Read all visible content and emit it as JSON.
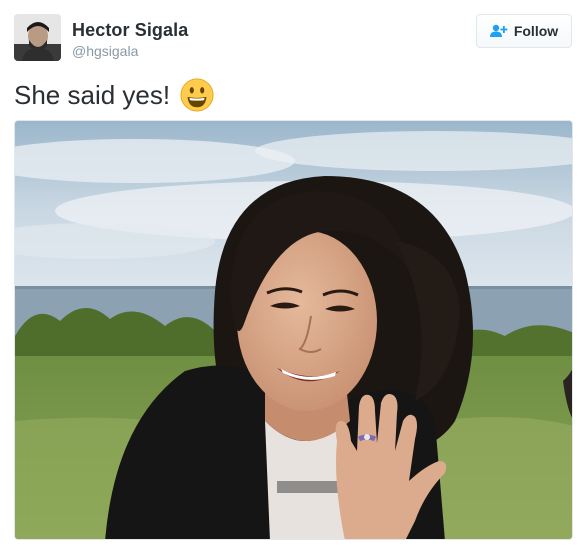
{
  "tweet": {
    "author": {
      "display_name": "Hector Sigala",
      "handle": "@hgsigala"
    },
    "follow_label": "Follow",
    "text": "She said yes!",
    "emoji": "smiley-face-emoji",
    "icons": {
      "follow": "add-user-icon"
    }
  },
  "colors": {
    "text_primary": "#292f33",
    "text_secondary": "#8899a6",
    "accent": "#1da1f2",
    "border": "#e1e8ed"
  }
}
